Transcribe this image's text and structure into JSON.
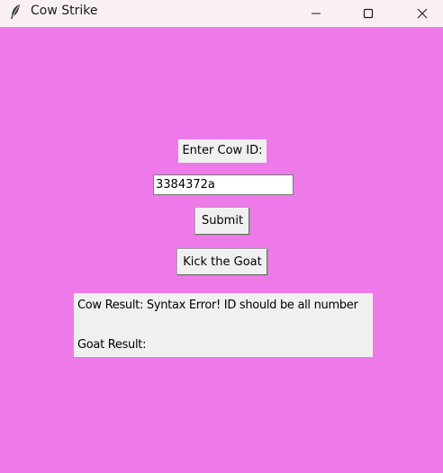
{
  "window": {
    "title": "Cow Strike",
    "app_icon": "feather-icon",
    "controls": {
      "minimize": "minimize-icon",
      "maximize": "maximize-icon",
      "close": "close-icon"
    }
  },
  "form": {
    "cow_id_label": "Enter Cow ID:",
    "cow_id_value": "3384372a",
    "submit_label": "Submit",
    "kick_label": "Kick the Goat"
  },
  "results": {
    "cow_result": "Cow Result: Syntax Error! ID should be all number",
    "goat_result": "Goat Result:"
  },
  "colors": {
    "background": "#ee7aea",
    "titlebar": "#f9f0f3",
    "widget": "#f0f0f0"
  }
}
